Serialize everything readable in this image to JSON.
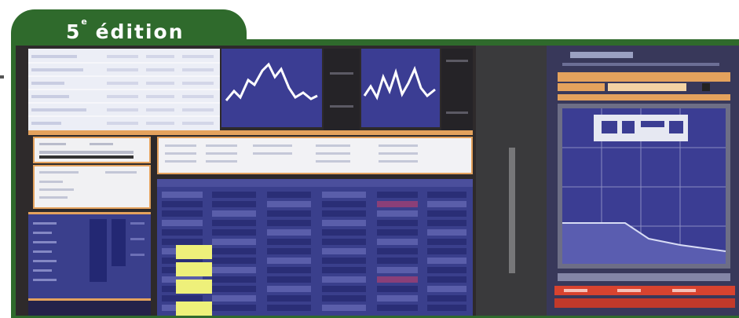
{
  "edition_tab": {
    "label_number": "5",
    "label_sup": "e",
    "label_word": "édition"
  },
  "colors": {
    "frame_green": "#2f6a2c",
    "screen_dark": "#2e2a2b",
    "panel_blue": "#3a3f8c",
    "chart_blue": "#3b3d93",
    "orange_accent": "#e4a25d",
    "highlight_yellow": "#eef07a",
    "red_accent": "#d8432f"
  }
}
